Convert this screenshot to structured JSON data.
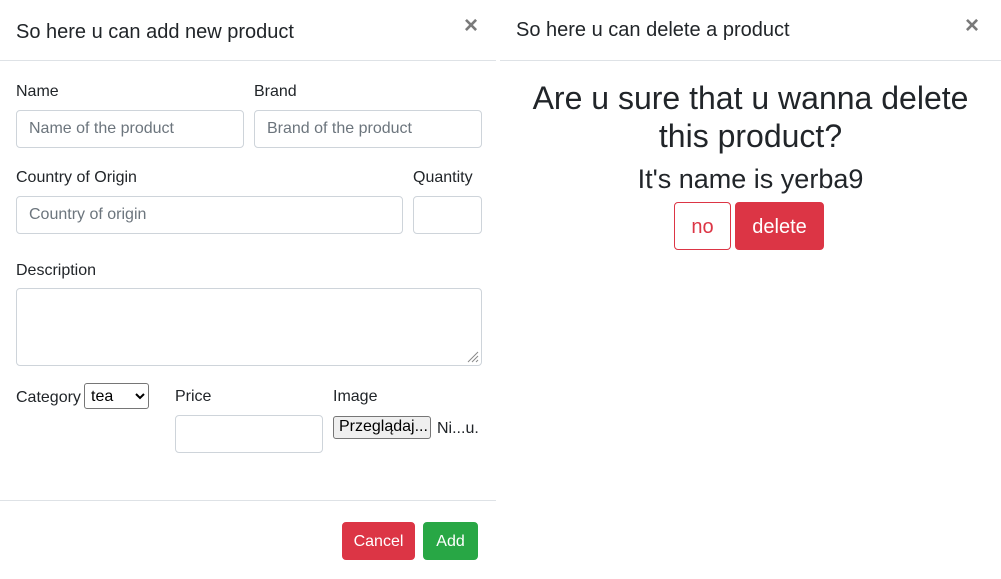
{
  "add_modal": {
    "title": "So here u can add new product",
    "close_glyph": "×",
    "fields": {
      "name": {
        "label": "Name",
        "placeholder": "Name of the product",
        "value": ""
      },
      "brand": {
        "label": "Brand",
        "placeholder": "Brand of the product",
        "value": ""
      },
      "country": {
        "label": "Country of Origin",
        "placeholder": "Country of origin",
        "value": ""
      },
      "quantity": {
        "label": "Quantity",
        "value": ""
      },
      "description": {
        "label": "Description",
        "value": ""
      },
      "category": {
        "label": "Category",
        "selected": "tea"
      },
      "price": {
        "label": "Price",
        "value": ""
      },
      "image": {
        "label": "Image",
        "button": "Przeglądaj...",
        "status": "Ni...u."
      }
    },
    "buttons": {
      "cancel": "Cancel",
      "add": "Add"
    }
  },
  "delete_modal": {
    "title": "So here u can delete a product",
    "close_glyph": "×",
    "question_line1": "Are u sure that u wanna delete",
    "question_line2": "this product?",
    "name_line": "It's name is yerba9",
    "buttons": {
      "no": "no",
      "delete": "delete"
    }
  },
  "colors": {
    "danger": "#dc3545",
    "success": "#28a745",
    "border": "#ced4da",
    "divider": "#dee2e6"
  }
}
